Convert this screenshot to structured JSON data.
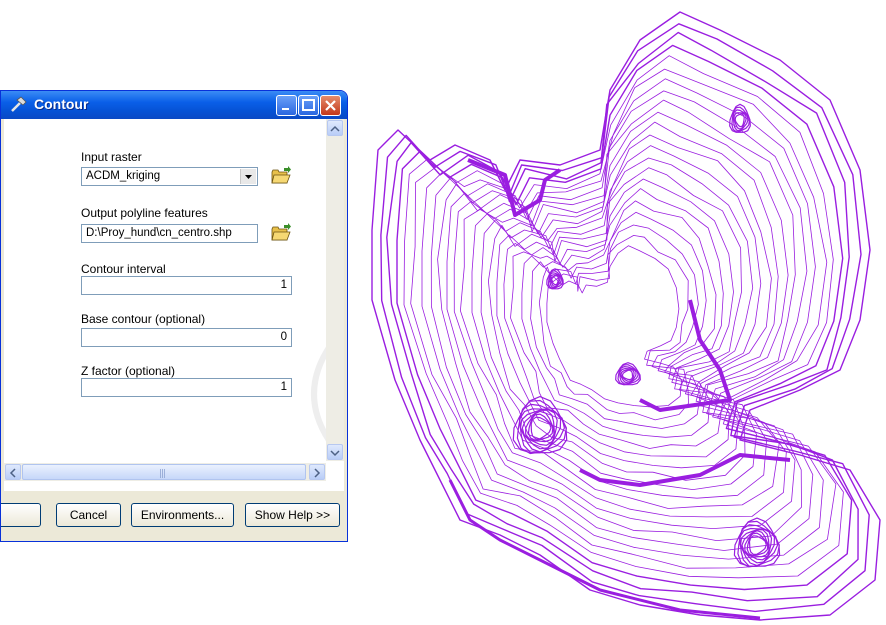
{
  "dialog": {
    "title": "Contour",
    "fields": {
      "input_raster": {
        "label": "Input raster",
        "value": "ACDM_kriging"
      },
      "output_features": {
        "label": "Output polyline features",
        "value": "D:\\Proy_hund\\cn_centro.shp"
      },
      "contour_interval": {
        "label": "Contour interval",
        "value": "1"
      },
      "base_contour": {
        "label": "Base contour (optional)",
        "value": "0"
      },
      "z_factor": {
        "label": "Z factor (optional)",
        "value": "1"
      }
    },
    "buttons": {
      "ok": "",
      "cancel": "Cancel",
      "environments": "Environments...",
      "show_help": "Show Help >>"
    }
  },
  "map": {
    "contour_color": "#9a1ee0",
    "icon": "contour-lines-map"
  },
  "colors": {
    "titlebar": "#0a5fe8",
    "window_bg": "#ece9d8"
  }
}
